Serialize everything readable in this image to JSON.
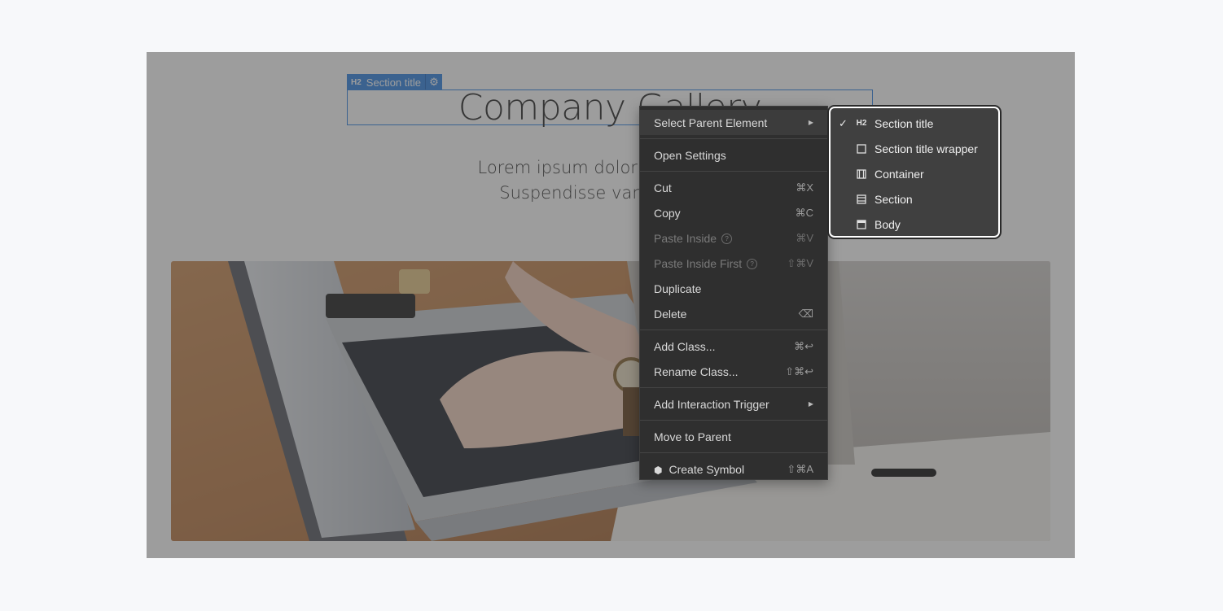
{
  "canvas": {
    "element_badge": {
      "type": "H2",
      "label": "Section title",
      "settings_icon": "gear-icon"
    },
    "heading": "Company Gallery",
    "paragraph_line1": "Lorem ipsum dolor sit amet, co",
    "paragraph_line2": "Suspendisse varius enim i"
  },
  "context_menu": {
    "select_parent": "Select Parent Element",
    "open_settings": "Open Settings",
    "cut": {
      "label": "Cut",
      "shortcut": "⌘X"
    },
    "copy": {
      "label": "Copy",
      "shortcut": "⌘C"
    },
    "paste_inside": {
      "label": "Paste Inside",
      "shortcut": "⌘V"
    },
    "paste_inside_first": {
      "label": "Paste Inside First",
      "shortcut": "⇧⌘V"
    },
    "duplicate": "Duplicate",
    "delete": {
      "label": "Delete",
      "shortcut": "⌫"
    },
    "add_class": {
      "label": "Add Class...",
      "shortcut": "⌘↩"
    },
    "rename_class": {
      "label": "Rename Class...",
      "shortcut": "⇧⌘↩"
    },
    "add_interaction": "Add Interaction Trigger",
    "move_to_parent": "Move to Parent",
    "create_symbol": {
      "label": "Create Symbol",
      "shortcut": "⇧⌘A"
    }
  },
  "parent_submenu": {
    "items": [
      {
        "label": "Section title",
        "icon": "h2-icon",
        "checked": true
      },
      {
        "label": "Section title wrapper",
        "icon": "square-icon",
        "checked": false
      },
      {
        "label": "Container",
        "icon": "container-icon",
        "checked": false
      },
      {
        "label": "Section",
        "icon": "section-icon",
        "checked": false
      },
      {
        "label": "Body",
        "icon": "body-icon",
        "checked": false
      }
    ]
  }
}
